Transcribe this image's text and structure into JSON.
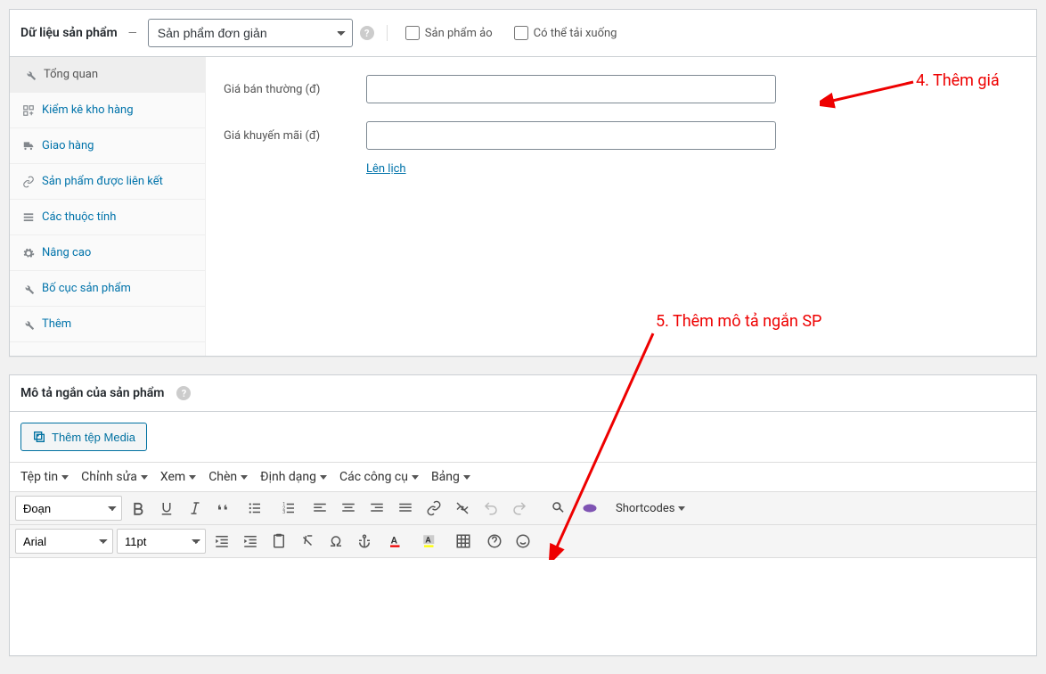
{
  "product_data": {
    "title": "Dữ liệu sản phẩm",
    "dash": "—",
    "product_type_value": "Sản phẩm đơn giản",
    "virtual_label": "Sản phẩm ảo",
    "downloadable_label": "Có thể tải xuống",
    "tabs": [
      {
        "label": "Tổng quan",
        "icon": "wrench"
      },
      {
        "label": "Kiểm kê kho hàng",
        "icon": "inventory"
      },
      {
        "label": "Giao hàng",
        "icon": "truck"
      },
      {
        "label": "Sản phẩm được liên kết",
        "icon": "link"
      },
      {
        "label": "Các thuộc tính",
        "icon": "list"
      },
      {
        "label": "Nâng cao",
        "icon": "gear"
      },
      {
        "label": "Bố cục sản phẩm",
        "icon": "wrench"
      },
      {
        "label": "Thêm",
        "icon": "wrench"
      }
    ],
    "fields": {
      "regular_price_label": "Giá bán thường (đ)",
      "regular_price_value": "",
      "sale_price_label": "Giá khuyến mãi (đ)",
      "sale_price_value": "",
      "schedule_link": "Lên lịch"
    }
  },
  "short_desc": {
    "title": "Mô tả ngắn của sản phẩm",
    "add_media_btn": "Thêm tệp Media",
    "menu": {
      "file": "Tệp tin",
      "edit": "Chỉnh sửa",
      "view": "Xem",
      "insert": "Chèn",
      "format": "Định dạng",
      "tools": "Các công cụ",
      "table": "Bảng"
    },
    "toolbar1": {
      "format_select": "Đoạn",
      "shortcodes": "Shortcodes"
    },
    "toolbar2": {
      "font_select": "Arial",
      "size_select": "11pt"
    }
  },
  "annotations": {
    "a4": "4. Thêm giá",
    "a5": "5. Thêm mô tả ngắn SP"
  }
}
